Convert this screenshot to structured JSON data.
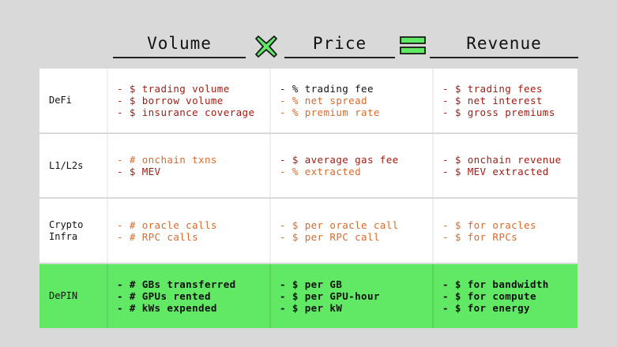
{
  "headers": {
    "volume": "Volume",
    "price": "Price",
    "revenue": "Revenue"
  },
  "operators": {
    "multiply_icon": "x-multiply-icon",
    "equals_icon": "equals-icon",
    "color": "#61e865"
  },
  "colors": {
    "red": "#9b1c12",
    "orange": "#d96a2c",
    "green_row": "#61e865"
  },
  "rows": [
    {
      "label": "DeFi",
      "volume": [
        "- $ trading volume",
        "- $ borrow volume",
        "- $ insurance coverage"
      ],
      "price": [
        "- % trading fee",
        "- % net spread",
        "- % premium rate"
      ],
      "revenue": [
        "- $ trading fees",
        "- $ net interest",
        "- $ gross premiums"
      ]
    },
    {
      "label": "L1/L2s",
      "volume": [
        "- # onchain txns",
        "- $ MEV"
      ],
      "price": [
        "- $ average gas fee",
        "- % extracted"
      ],
      "revenue": [
        "- $ onchain revenue",
        "- $ MEV extracted"
      ]
    },
    {
      "label": "Crypto\nInfra",
      "volume": [
        "- # oracle calls",
        "- # RPC calls"
      ],
      "price": [
        "- $ per oracle call",
        "- $ per RPC call"
      ],
      "revenue": [
        "- $ for oracles",
        "- $ for RPCs"
      ]
    },
    {
      "label": "DePIN",
      "volume": [
        "- # GBs transferred",
        "- # GPUs rented",
        "- # kWs expended"
      ],
      "price": [
        "- $ per GB",
        "- $ per GPU-hour",
        "- $ per kW"
      ],
      "revenue": [
        "- $ for bandwidth",
        "- $ for compute",
        "- $ for energy"
      ]
    }
  ]
}
